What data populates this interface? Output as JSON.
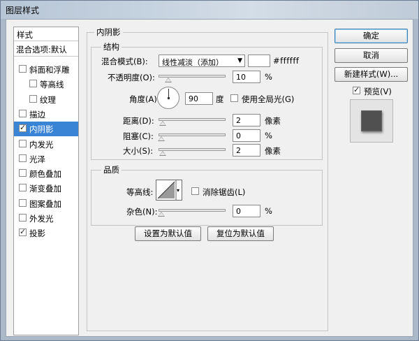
{
  "window": {
    "title": "图层样式"
  },
  "left_panel": {
    "header": "样式",
    "blend_options": "混合选项:默认",
    "items": [
      {
        "label": "斜面和浮雕",
        "checked": false,
        "indent": false,
        "selected": false
      },
      {
        "label": "等高线",
        "checked": false,
        "indent": true,
        "selected": false
      },
      {
        "label": "纹理",
        "checked": false,
        "indent": true,
        "selected": false
      },
      {
        "label": "描边",
        "checked": false,
        "indent": false,
        "selected": false
      },
      {
        "label": "内阴影",
        "checked": true,
        "indent": false,
        "selected": true
      },
      {
        "label": "内发光",
        "checked": false,
        "indent": false,
        "selected": false
      },
      {
        "label": "光泽",
        "checked": false,
        "indent": false,
        "selected": false
      },
      {
        "label": "颜色叠加",
        "checked": false,
        "indent": false,
        "selected": false
      },
      {
        "label": "渐变叠加",
        "checked": false,
        "indent": false,
        "selected": false
      },
      {
        "label": "图案叠加",
        "checked": false,
        "indent": false,
        "selected": false
      },
      {
        "label": "外发光",
        "checked": false,
        "indent": false,
        "selected": false
      },
      {
        "label": "投影",
        "checked": true,
        "indent": false,
        "selected": false
      }
    ]
  },
  "inner_shadow": {
    "group_title": "内阴影",
    "structure": {
      "title": "结构",
      "blend_mode_label": "混合模式(B):",
      "blend_mode_value": "线性减淡（添加）",
      "color_hex": "#ffffff",
      "opacity_label": "不透明度(O):",
      "opacity_value": "10",
      "opacity_unit": "%",
      "angle_label": "角度(A):",
      "angle_value": "90",
      "angle_unit": "度",
      "global_light_label": "使用全局光(G)",
      "global_light_checked": false,
      "distance_label": "距离(D):",
      "distance_value": "2",
      "distance_unit": "像素",
      "choke_label": "阻塞(C):",
      "choke_value": "0",
      "choke_unit": "%",
      "size_label": "大小(S):",
      "size_value": "2",
      "size_unit": "像素"
    },
    "quality": {
      "title": "品质",
      "contour_label": "等高线:",
      "anti_alias_label": "消除锯齿(L)",
      "anti_alias_checked": false,
      "noise_label": "杂色(N):",
      "noise_value": "0",
      "noise_unit": "%"
    },
    "set_default_button": "设置为默认值",
    "reset_default_button": "复位为默认值"
  },
  "right_panel": {
    "ok_button": "确定",
    "cancel_button": "取消",
    "new_style_button": "新建样式(W)...",
    "preview_label": "预览(V)",
    "preview_checked": true
  },
  "slider_levels": {
    "opacity": 0.1,
    "distance": 0.02,
    "choke": 0.0,
    "size": 0.02,
    "noise": 0.0
  },
  "colors": {
    "selection": "#3a84d6",
    "swatch": "#ffffff"
  }
}
